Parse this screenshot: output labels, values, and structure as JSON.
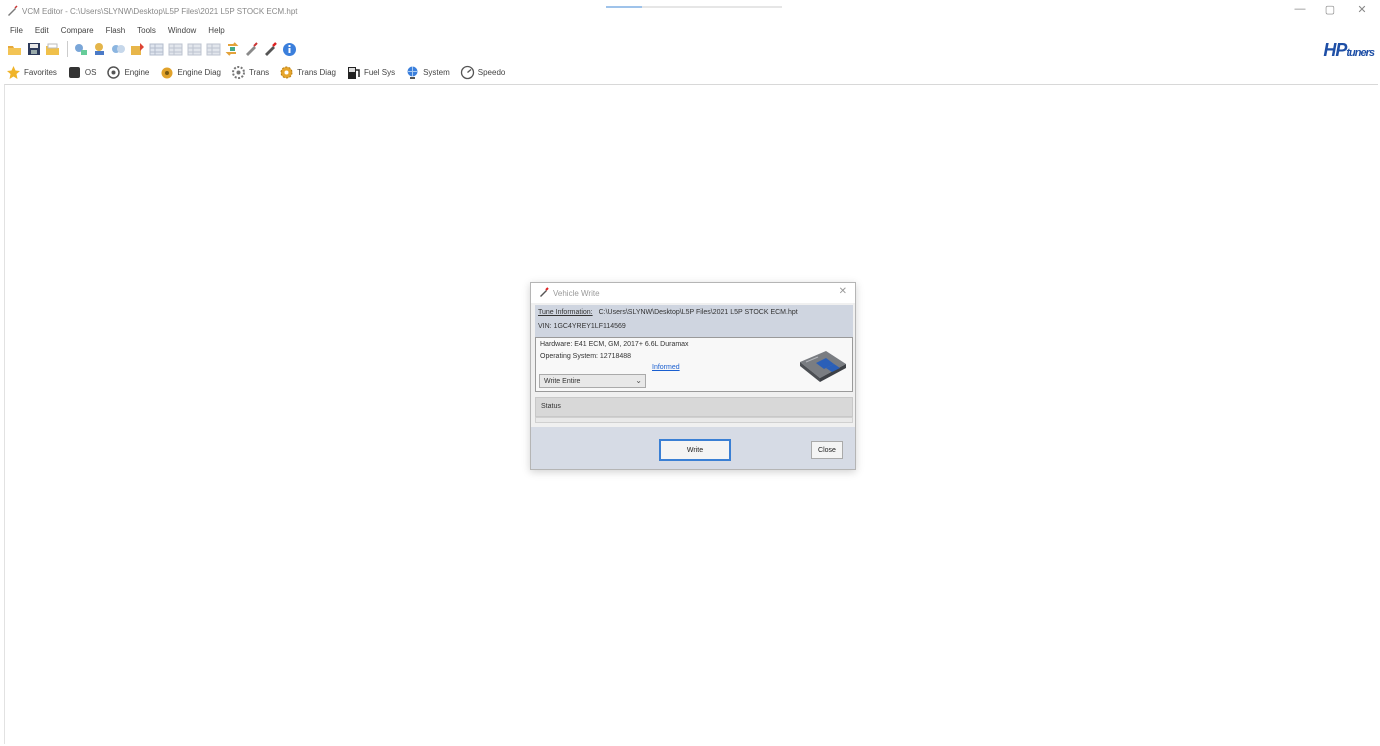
{
  "window": {
    "title": "VCM Editor - C:\\Users\\SLYNW\\Desktop\\L5P Files\\2021 L5P STOCK ECM.hpt",
    "minimize": "—",
    "maximize": "▢",
    "close": "✕"
  },
  "menu": [
    "File",
    "Edit",
    "Compare",
    "Flash",
    "Tools",
    "Window",
    "Help"
  ],
  "brand": {
    "logo_main": "HP",
    "logo_sub": "tuners",
    "color": "#1e4fa6"
  },
  "categories": [
    {
      "label": "Favorites",
      "icon": "star-icon"
    },
    {
      "label": "OS",
      "icon": "chip-icon"
    },
    {
      "label": "Engine",
      "icon": "engine-icon"
    },
    {
      "label": "Engine Diag",
      "icon": "engine-diag-icon"
    },
    {
      "label": "Trans",
      "icon": "gear-icon"
    },
    {
      "label": "Trans Diag",
      "icon": "gear-diag-icon"
    },
    {
      "label": "Fuel Sys",
      "icon": "fuel-pump-icon"
    },
    {
      "label": "System",
      "icon": "globe-icon"
    },
    {
      "label": "Speedo",
      "icon": "speedometer-icon"
    }
  ],
  "dialog": {
    "title": "Vehicle Write",
    "tune_info_label": "Tune Information:",
    "tune_info_value": "C:\\Users\\SLYNW\\Desktop\\L5P Files\\2021 L5P STOCK ECM.hpt",
    "vin": "VIN: 1GC4YREY1LF114569",
    "hardware": "Hardware: E41 ECM, GM, 2017+ 6.6L Duramax",
    "os": "Operating System: 12718488",
    "write_mode": "Write Entire",
    "link": "Informed",
    "status_label": "Status",
    "write_button": "Write",
    "close_button": "Close"
  }
}
